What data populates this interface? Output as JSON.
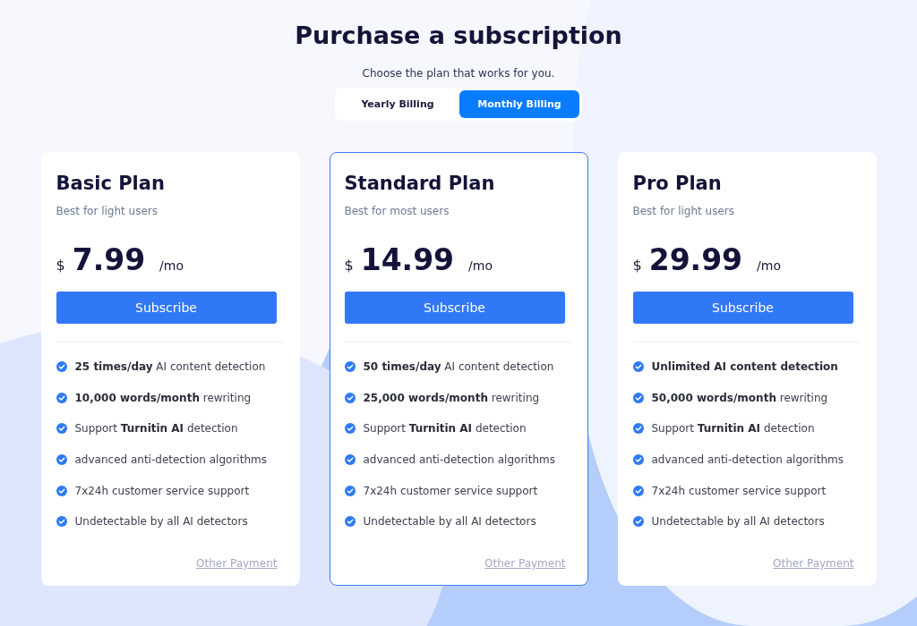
{
  "title": "Purchase a subscription",
  "subtitle": "Choose the plan that works for you.",
  "billing_tabs": [
    {
      "label": "Yearly Billing",
      "selected": false
    },
    {
      "label": "Monthly Billing",
      "selected": true
    }
  ],
  "plans": [
    {
      "name": "Basic Plan",
      "tagline": "Best for light users",
      "currency": "$",
      "price": "7.99",
      "period": "/mo",
      "button": "Subscribe",
      "selected": false,
      "features": [
        "**25 times/day** AI content detection",
        "**10,000 words/month** rewriting",
        "Support **Turnitin AI** detection",
        "advanced anti-detection algorithms",
        "7x24h customer service support",
        "Undetectable by all AI detectors"
      ],
      "link": "Other Payment"
    },
    {
      "name": "Standard Plan",
      "tagline": "Best for most users",
      "currency": "$",
      "price": "14.99",
      "period": "/mo",
      "button": "Subscribe",
      "selected": true,
      "features": [
        "**50 times/day** AI content detection",
        "**25,000 words/month** rewriting",
        "Support **Turnitin AI** detection",
        "advanced anti-detection algorithms",
        "7x24h customer service support",
        "Undetectable by all AI detectors"
      ],
      "link": "Other Payment"
    },
    {
      "name": "Pro Plan",
      "tagline": "Best for light users",
      "currency": "$",
      "price": "29.99",
      "period": "/mo",
      "button": "Subscribe",
      "selected": false,
      "features": [
        "**Unlimited AI content detection**",
        "**50,000 words/month** rewriting",
        "Support **Turnitin AI** detection",
        "advanced anti-detection algorithms",
        "7x24h customer service support",
        "Undetectable by all AI detectors"
      ],
      "link": "Other Payment"
    }
  ]
}
